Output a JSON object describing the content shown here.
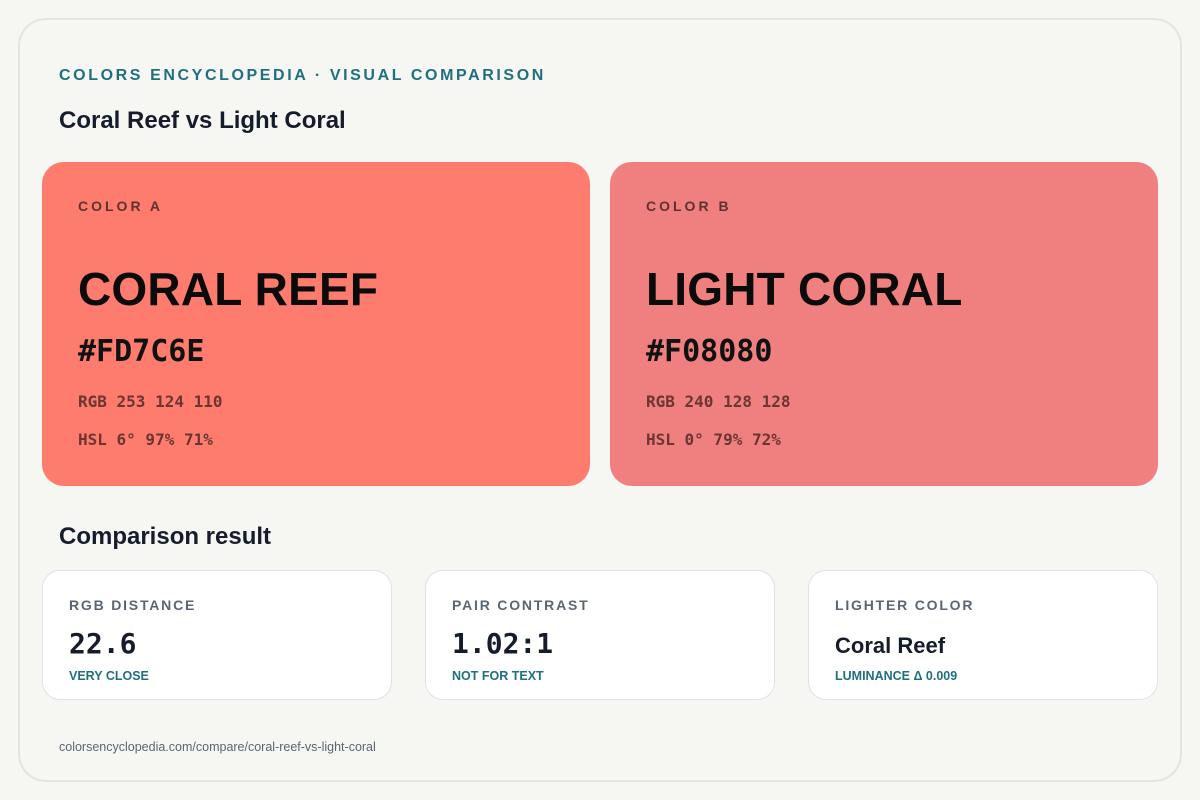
{
  "header": {
    "eyebrow": "COLORS ENCYCLOPEDIA · VISUAL COMPARISON",
    "title": "Coral Reef vs Light Coral"
  },
  "colors": [
    {
      "label": "COLOR A",
      "name": "CORAL REEF",
      "hex": "#FD7C6E",
      "rgb": "RGB 253 124 110",
      "hsl": "HSL 6° 97% 71%",
      "swatch_color": "#fd7c6e"
    },
    {
      "label": "COLOR B",
      "name": "LIGHT CORAL",
      "hex": "#F08080",
      "rgb": "RGB 240 128 128",
      "hsl": "HSL 0° 79% 72%",
      "swatch_color": "#f08080"
    }
  ],
  "comparison": {
    "title": "Comparison result",
    "cards": [
      {
        "label": "RGB DISTANCE",
        "value": "22.6",
        "note": "VERY CLOSE"
      },
      {
        "label": "PAIR CONTRAST",
        "value": "1.02:1",
        "note": "NOT FOR TEXT"
      },
      {
        "label": "LIGHTER COLOR",
        "value": "Coral Reef",
        "note": "LUMINANCE Δ 0.009"
      }
    ]
  },
  "footer": {
    "url": "colorsencyclopedia.com/compare/coral-reef-vs-light-coral"
  },
  "theme": {
    "accent": "#1f6f80",
    "background": "#f6f6f2",
    "heading": "#151c2b"
  }
}
